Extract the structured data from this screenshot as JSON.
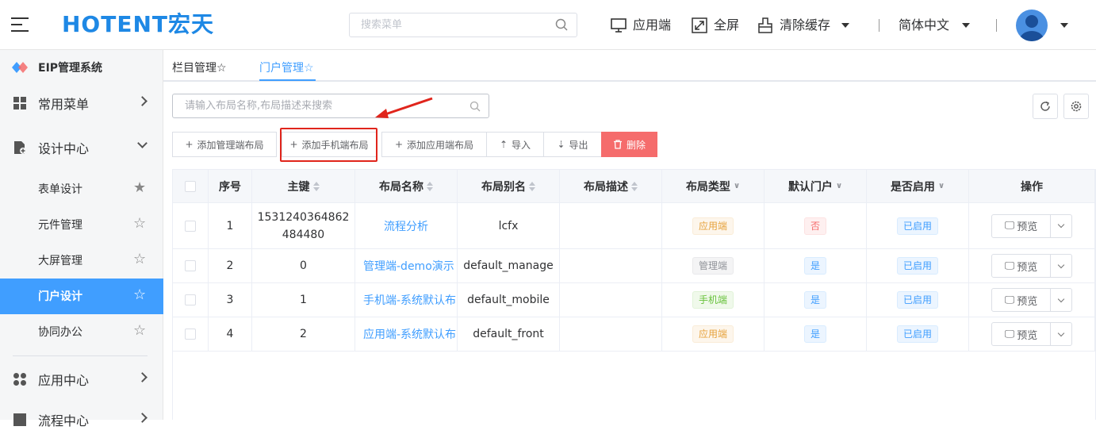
{
  "header": {
    "logo_text": "HOTENT宏天",
    "search_placeholder": "搜索菜单",
    "app_side_label": "应用端",
    "fullscreen_label": "全屏",
    "clear_cache_label": "清除缓存",
    "language_label": "简体中文"
  },
  "sidebar": {
    "system_name": "EIP管理系统",
    "items": [
      {
        "label": "常用菜单"
      },
      {
        "label": "设计中心"
      },
      {
        "label": "表单设计"
      },
      {
        "label": "元件管理"
      },
      {
        "label": "大屏管理"
      },
      {
        "label": "门户设计"
      },
      {
        "label": "协同办公"
      },
      {
        "label": "应用中心"
      },
      {
        "label": "流程中心"
      }
    ]
  },
  "tabs": [
    {
      "label": "栏目管理"
    },
    {
      "label": "门户管理"
    }
  ],
  "toolbar": {
    "search_placeholder": "请输入布局名称,布局描述来搜索",
    "add_manage_label": "添加管理端布局",
    "add_mobile_label": "添加手机端布局",
    "add_app_label": "添加应用端布局",
    "import_label": "导入",
    "export_label": "导出",
    "delete_label": "删除"
  },
  "table": {
    "headers": [
      "序号",
      "主键",
      "布局名称",
      "布局别名",
      "布局描述",
      "布局类型",
      "默认门户",
      "是否启用",
      "操作"
    ],
    "rows": [
      {
        "index": "1",
        "id_line1": "1531240364862",
        "id_line2": "484480",
        "name": "流程分析",
        "alias": "lcfx",
        "desc": "",
        "type": "应用端",
        "default": "否",
        "enabled": "已启用",
        "action": "预览"
      },
      {
        "index": "2",
        "id_line1": "0",
        "id_line2": "",
        "name": "管理端-demo演示",
        "alias": "default_manage",
        "desc": "",
        "type": "管理端",
        "default": "是",
        "enabled": "已启用",
        "action": "预览"
      },
      {
        "index": "3",
        "id_line1": "1",
        "id_line2": "",
        "name": "手机端-系统默认布",
        "alias": "default_mobile",
        "desc": "",
        "type": "手机端",
        "default": "是",
        "enabled": "已启用",
        "action": "预览"
      },
      {
        "index": "4",
        "id_line1": "2",
        "id_line2": "",
        "name": "应用端-系统默认布",
        "alias": "default_front",
        "desc": "",
        "type": "应用端",
        "default": "是",
        "enabled": "已启用",
        "action": "预览"
      }
    ]
  },
  "colors": {
    "accent": "#409eff",
    "danger": "#f56c6c",
    "logo": "#1e88e5",
    "highlight": "#e0251c"
  }
}
